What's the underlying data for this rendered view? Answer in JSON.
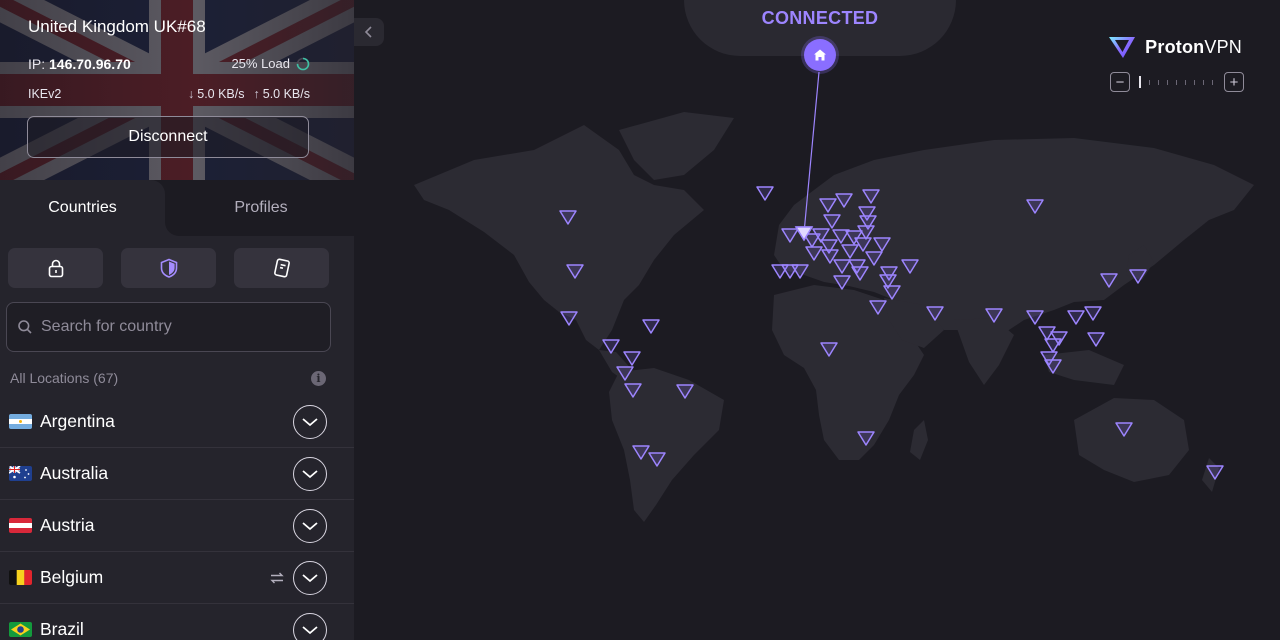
{
  "connection": {
    "server": "United Kingdom UK#68",
    "ip_label": "IP:",
    "ip": "146.70.96.70",
    "load": "25% Load",
    "load_fraction": 0.25,
    "protocol": "IKEv2",
    "download": "5.0 KB/s",
    "upload": "5.0 KB/s",
    "disconnect_label": "Disconnect",
    "status": "CONNECTED"
  },
  "tabs": {
    "countries": "Countries",
    "profiles": "Profiles"
  },
  "filters": [
    "lock-icon",
    "shield-icon",
    "secure-core-icon"
  ],
  "search": {
    "placeholder": "Search for country"
  },
  "locations": {
    "header": "All Locations (67)",
    "countries": [
      {
        "name": "Argentina",
        "flag": "argentina",
        "p2p": false
      },
      {
        "name": "Australia",
        "flag": "australia",
        "p2p": false
      },
      {
        "name": "Austria",
        "flag": "austria",
        "p2p": false
      },
      {
        "name": "Belgium",
        "flag": "belgium",
        "p2p": true
      },
      {
        "name": "Brazil",
        "flag": "brazil",
        "p2p": false
      }
    ]
  },
  "brand": {
    "name_bold": "Proton",
    "name_regular": "VPN"
  },
  "colors": {
    "accent": "#8a6eff",
    "accent_text": "#9d85ff",
    "background": "#1c1b22",
    "sidebar": "#25242c"
  }
}
